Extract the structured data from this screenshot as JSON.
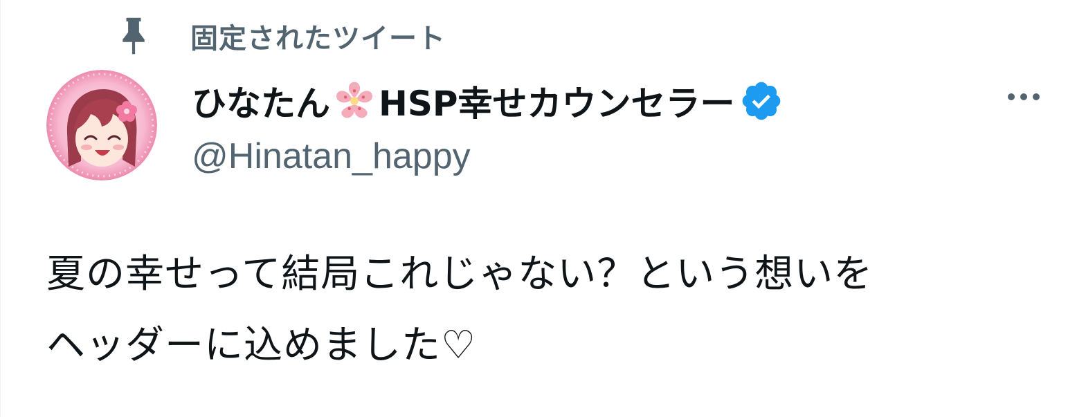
{
  "pinned": {
    "icon": "pin-icon",
    "label": "固定されたツイート"
  },
  "author": {
    "avatar": "avatar-image",
    "name_part1": "ひなたん",
    "name_emoji": "cherry-blossom-icon",
    "name_part2": "HSP幸せカウンセラー",
    "verified_icon": "verified-badge-icon",
    "verified_color": "#1d9bf0",
    "handle": "@Hinatan_happy"
  },
  "more_button": {
    "icon": "more-horizontal-icon"
  },
  "tweet": {
    "text_line1": "夏の幸せって結局これじゃない？という想いを",
    "text_line2": "ヘッダーに込めました♡"
  },
  "colors": {
    "text_primary": "#0f1419",
    "text_secondary": "#536471",
    "accent_pink": "#f4a3c4"
  }
}
